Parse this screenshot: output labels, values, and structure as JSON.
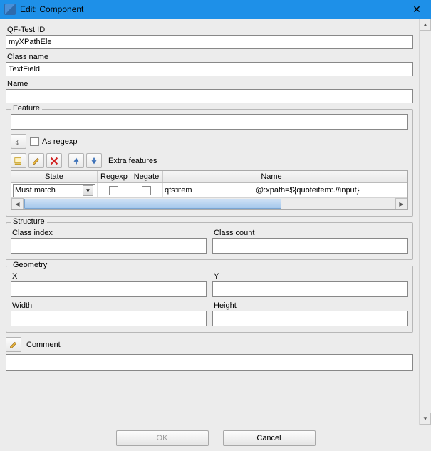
{
  "window": {
    "title": "Edit: Component"
  },
  "fields": {
    "qftest_id": {
      "label": "QF-Test ID",
      "value": "myXPathEle"
    },
    "class_name": {
      "label": "Class name",
      "value": "TextField"
    },
    "name": {
      "label": "Name",
      "value": ""
    }
  },
  "feature": {
    "legend": "Feature",
    "value": "",
    "as_regexp_label": "As regexp",
    "extra_features_label": "Extra features",
    "columns": {
      "state": "State",
      "regexp": "Regexp",
      "negate": "Negate",
      "name": "Name"
    },
    "row": {
      "state": "Must match",
      "regexp_checked": false,
      "negate_checked": false,
      "name": "qfs:item",
      "value": "@:xpath=${quoteitem:.//input}"
    }
  },
  "structure": {
    "legend": "Structure",
    "class_index": {
      "label": "Class index",
      "value": ""
    },
    "class_count": {
      "label": "Class count",
      "value": ""
    }
  },
  "geometry": {
    "legend": "Geometry",
    "x": {
      "label": "X",
      "value": ""
    },
    "y": {
      "label": "Y",
      "value": ""
    },
    "width": {
      "label": "Width",
      "value": ""
    },
    "height": {
      "label": "Height",
      "value": ""
    }
  },
  "comment": {
    "label": "Comment",
    "value": ""
  },
  "buttons": {
    "ok": "OK",
    "cancel": "Cancel"
  }
}
